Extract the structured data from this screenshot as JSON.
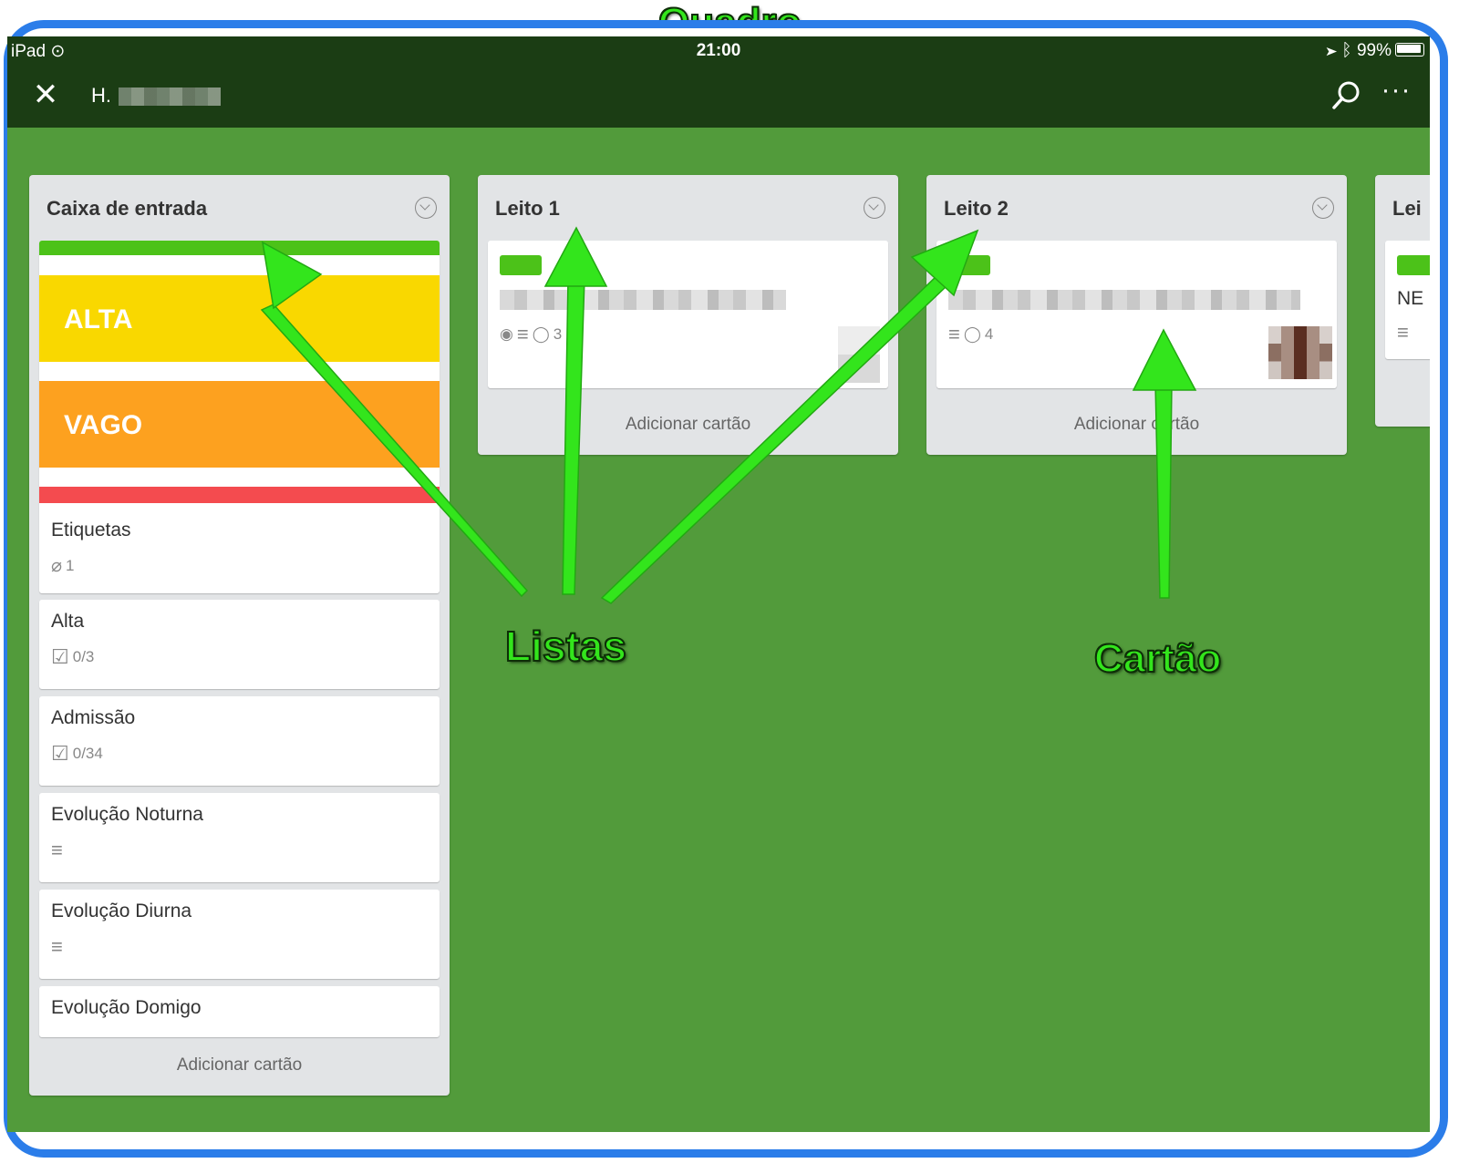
{
  "annotations": {
    "board": "Quadro",
    "lists": "Listas",
    "card": "Cartão"
  },
  "status_bar": {
    "device": "iPad",
    "time": "21:00",
    "battery": "99%"
  },
  "nav": {
    "title": "H."
  },
  "lists": [
    {
      "title": "Caixa de entrada",
      "label_colors": [
        "#4cc219",
        "#f9d800",
        "#fda11f",
        "#f44b4f"
      ],
      "label_texts": [
        "ALTA",
        "VAGO"
      ],
      "cards": [
        {
          "title": "Etiquetas",
          "badge": "1"
        },
        {
          "title": "Alta",
          "badge": "0/3"
        },
        {
          "title": "Admissão",
          "badge": "0/34"
        },
        {
          "title": "Evolução Noturna"
        },
        {
          "title": "Evolução Diurna"
        },
        {
          "title": "Evolução Domigo"
        }
      ],
      "add_card": "Adicionar cartão"
    },
    {
      "title": "Leito 1",
      "cards": [
        {
          "comments": "3"
        }
      ],
      "add_card": "Adicionar cartão"
    },
    {
      "title": "Leito 2",
      "cards": [
        {
          "comments": "4"
        }
      ],
      "add_card": "Adicionar cartão"
    },
    {
      "title": "Lei",
      "cards": [
        {
          "title": "NE"
        }
      ]
    }
  ],
  "colors": {
    "board_bg": "#529b3b",
    "nav_bg": "#1b3d14",
    "frame": "#2b7de9",
    "annotation": "#33e51c"
  }
}
